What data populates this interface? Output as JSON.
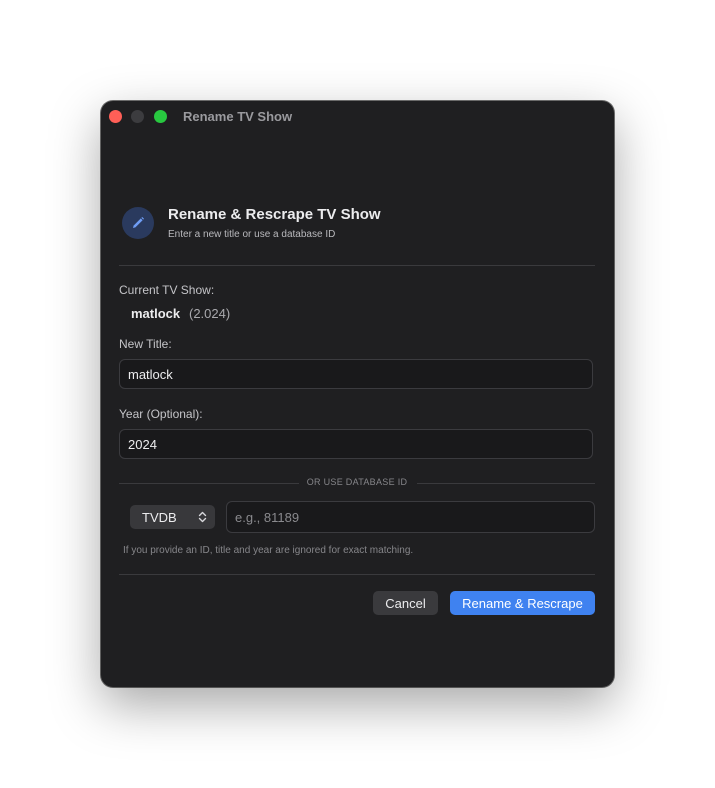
{
  "window": {
    "title": "Rename TV Show"
  },
  "header": {
    "icon": "pencil-icon",
    "title": "Rename & Rescrape TV Show",
    "subtitle": "Enter a new title or use a database ID"
  },
  "current": {
    "label": "Current TV Show:",
    "name": "matlock",
    "year": "(2.024)"
  },
  "new_title": {
    "label": "New Title:",
    "value": "matlock"
  },
  "year": {
    "label": "Year (Optional):",
    "value": "2024"
  },
  "database": {
    "divider_text": "OR USE DATABASE ID",
    "source_selected": "TVDB",
    "id_value": "",
    "id_placeholder": "e.g., 81189",
    "hint": "If you provide an ID, title and year are ignored for exact matching."
  },
  "actions": {
    "cancel_label": "Cancel",
    "primary_label": "Rename & Rescrape"
  },
  "colors": {
    "window_bg": "#1f1f21",
    "accent": "#3f82f0",
    "close": "#ff5f57",
    "maximize": "#28c840"
  }
}
